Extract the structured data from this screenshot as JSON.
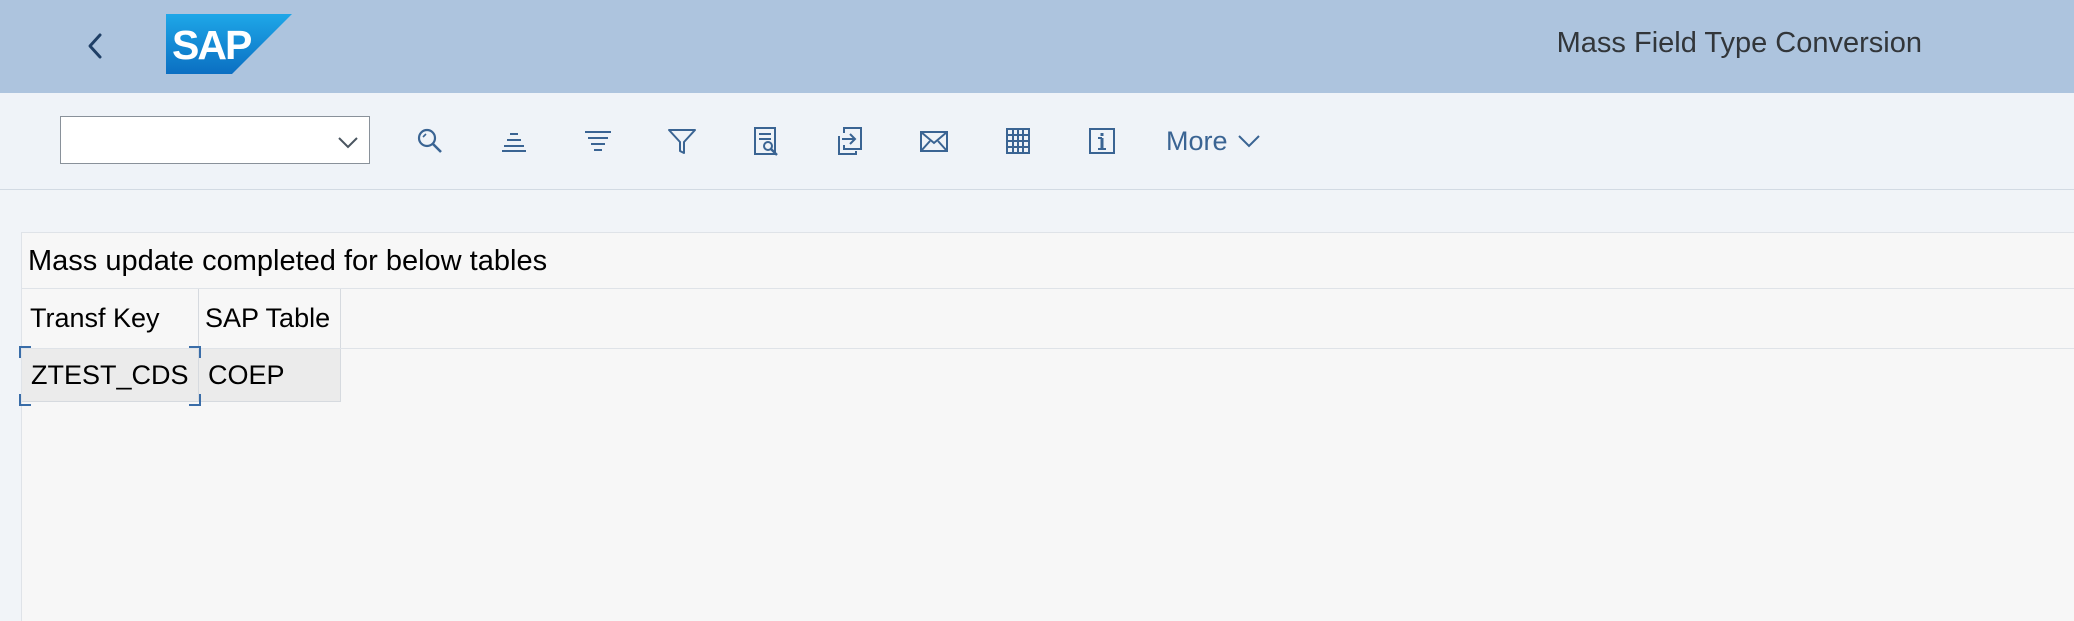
{
  "header": {
    "logo_text": "SAP",
    "title": "Mass Field Type Conversion"
  },
  "toolbar": {
    "variant_select": {
      "value": ""
    },
    "icons": [
      "search-icon",
      "sort-ascending-icon",
      "sort-descending-icon",
      "filter-icon",
      "print-preview-icon",
      "export-icon",
      "mail-icon",
      "spreadsheet-icon",
      "info-icon"
    ],
    "more_label": "More"
  },
  "content": {
    "title": "Mass update completed for below tables",
    "columns": [
      "Transf Key",
      "SAP Table"
    ],
    "rows": [
      [
        "ZTEST_CDS",
        "COEP"
      ]
    ]
  },
  "colors": {
    "header_bg": "#adc4de",
    "toolbar_bg": "#eff3f8",
    "accent": "#3a6493"
  }
}
